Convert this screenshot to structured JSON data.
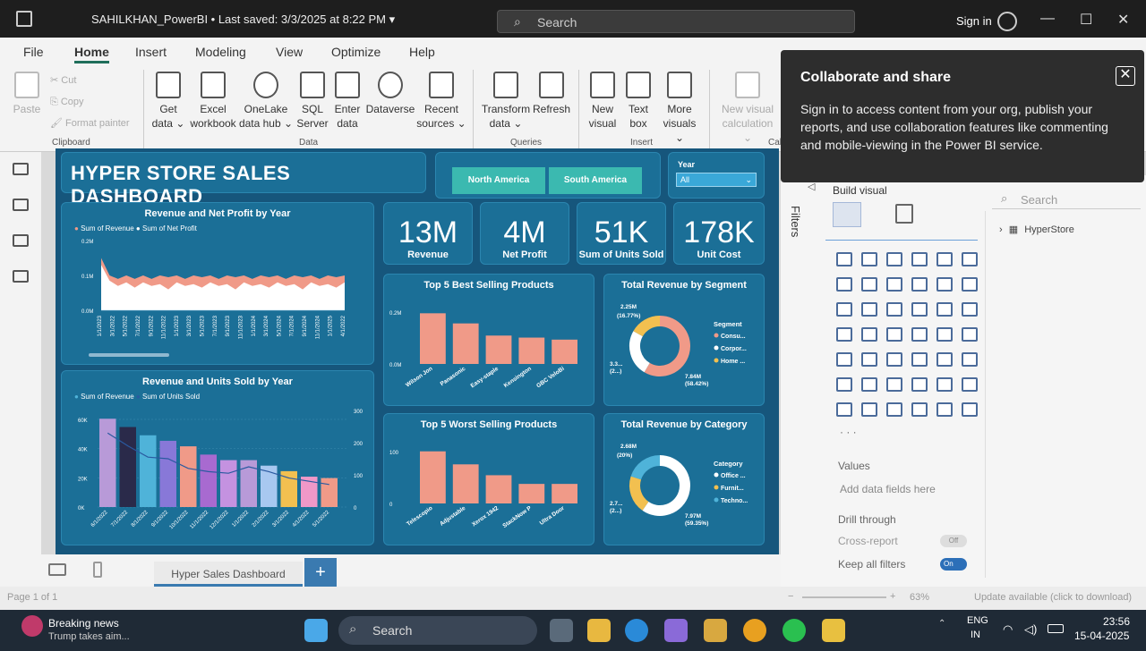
{
  "titlebar": {
    "title": "SAHILKHAN_PowerBI • Last saved: 3/3/2025 at 8:22 PM  ▾",
    "search_placeholder": "Search",
    "signin": "Sign in"
  },
  "ribbon": {
    "menus": [
      "File",
      "Home",
      "Insert",
      "Modeling",
      "View",
      "Optimize",
      "Help"
    ],
    "clipboard": {
      "paste": "Paste",
      "cut": "Cut",
      "copy": "Copy",
      "format_painter": "Format painter",
      "group": "Clipboard"
    },
    "data_buttons": [
      {
        "l1": "Get",
        "l2": "data ⌄"
      },
      {
        "l1": "Excel",
        "l2": "workbook"
      },
      {
        "l1": "OneLake",
        "l2": "data hub ⌄"
      },
      {
        "l1": "SQL",
        "l2": "Server"
      },
      {
        "l1": "Enter",
        "l2": "data"
      },
      {
        "l1": "Dataverse",
        "l2": ""
      },
      {
        "l1": "Recent",
        "l2": "sources ⌄"
      }
    ],
    "data_group": "Data",
    "queries_buttons": [
      {
        "l1": "Transform",
        "l2": "data ⌄"
      },
      {
        "l1": "Refresh",
        "l2": ""
      }
    ],
    "queries_group": "Queries",
    "insert_buttons": [
      {
        "l1": "New",
        "l2": "visual"
      },
      {
        "l1": "Text",
        "l2": "box"
      },
      {
        "l1": "More",
        "l2": "visuals ⌄"
      }
    ],
    "insert_group": "Insert",
    "calc_button": {
      "l1": "New visual",
      "l2": "calculation ⌄"
    },
    "calc_group": "Cal"
  },
  "tooltip": {
    "heading": "Collaborate and share",
    "body": "Sign in to access content from your org, publish your reports, and use collaboration features like commenting and mobile-viewing in the Power BI service."
  },
  "dashboard": {
    "title": "HYPER STORE SALES DASHBOARD",
    "regions": [
      "North America",
      "South America"
    ],
    "year_label": "Year",
    "year_value": "All",
    "kpis": [
      {
        "value": "13M",
        "label": "Revenue"
      },
      {
        "value": "4M",
        "label": "Net Profit"
      },
      {
        "value": "51K",
        "label": "Sum of Units Sold"
      },
      {
        "value": "178K",
        "label": "Unit Cost"
      }
    ]
  },
  "chart_data": [
    {
      "type": "area",
      "title": "Revenue and Net Profit by Year",
      "legend": [
        "Sum of Revenue",
        "Sum of Net Profit"
      ],
      "y_ticks": [
        "0.2M",
        "0.1M",
        "0.0M"
      ],
      "x_ticks": [
        "1/1/2023",
        "3/1/2022",
        "5/1/2022",
        "7/1/2022",
        "9/1/2022",
        "11/1/2022",
        "1/1/2023",
        "3/1/2023",
        "5/1/2023",
        "7/1/2023",
        "9/1/2023",
        "11/1/2023",
        "1/1/2024",
        "3/1/2024",
        "5/1/2024",
        "7/1/2024",
        "9/1/2024",
        "11/1/2024",
        "1/1/2025",
        "4/1/2022"
      ],
      "series": [
        {
          "name": "Sum of Revenue",
          "values": [
            0.15,
            0.1,
            0.09,
            0.1,
            0.09,
            0.1,
            0.09,
            0.1,
            0.095,
            0.1,
            0.09,
            0.1,
            0.095,
            0.1,
            0.09,
            0.1,
            0.095,
            0.1,
            0.09,
            0.1,
            0.095,
            0.1,
            0.09,
            0.1,
            0.095,
            0.1,
            0.09,
            0.1,
            0.095,
            0.1
          ]
        },
        {
          "name": "Sum of Net Profit",
          "values": [
            0.13,
            0.085,
            0.07,
            0.08,
            0.065,
            0.08,
            0.07,
            0.075,
            0.06,
            0.08,
            0.07,
            0.075,
            0.065,
            0.08,
            0.07,
            0.075,
            0.06,
            0.08,
            0.07,
            0.075,
            0.065,
            0.08,
            0.07,
            0.075,
            0.06,
            0.08,
            0.07,
            0.075,
            0.065,
            0.08
          ]
        }
      ],
      "ylim": [
        0,
        0.2
      ]
    },
    {
      "type": "bar",
      "title": "Revenue and Units Sold by Year",
      "legend": [
        "Sum of Revenue",
        "Sum of Units Sold"
      ],
      "y_ticks": [
        "60K",
        "40K",
        "20K",
        "0K"
      ],
      "y2_ticks": [
        "300",
        "200",
        "100",
        "0"
      ],
      "categories": [
        "6/1/2022",
        "7/1/2022",
        "8/1/2022",
        "9/1/2022",
        "10/1/2022",
        "11/1/2022",
        "12/1/2022",
        "1/1/2022",
        "2/1/2022",
        "3/1/2022",
        "4/1/2022",
        "5/1/2022"
      ],
      "values": [
        64000,
        58000,
        52000,
        48000,
        44000,
        38000,
        34000,
        34000,
        30000,
        26000,
        22000,
        21000
      ],
      "colors": [
        "#b89ad8",
        "#2a2a4a",
        "#4fb3d9",
        "#8878d8",
        "#f09a88",
        "#a86ad0",
        "#c492e0",
        "#b89ad8",
        "#a8c8f0",
        "#f2c050",
        "#f098c8",
        "#f09a88"
      ],
      "series2": [
        {
          "name": "Sum of Units Sold",
          "values": [
            230,
            190,
            155,
            150,
            120,
            110,
            105,
            125,
            110,
            90,
            80,
            70
          ]
        }
      ],
      "ylim": [
        0,
        70000
      ]
    },
    {
      "type": "bar",
      "title": "Top 5 Best Selling Products",
      "y_ticks": [
        "0.2M",
        "0.0M"
      ],
      "categories": [
        "Wilson Jon",
        "Panasonic",
        "Easy-staple",
        "Kensington",
        "GBC VeloBi"
      ],
      "values": [
        0.25,
        0.2,
        0.14,
        0.13,
        0.12
      ],
      "ylim": [
        0,
        0.3
      ]
    },
    {
      "type": "pie",
      "title": "Total Revenue by Segment",
      "legend_title": "Segment",
      "labels": [
        "Consu...",
        "Corpor...",
        "Home ..."
      ],
      "values": [
        7.84,
        3.3,
        2.25
      ],
      "colors": [
        "#f09a88",
        "#ffffff",
        "#f2c050"
      ],
      "data_labels": [
        "2.25M",
        "(16.77%)",
        "3.3...",
        "(2...)",
        "7.84M",
        "(58.42%)"
      ]
    },
    {
      "type": "bar",
      "title": "Top 5 Worst Selling Products",
      "y_ticks": [
        "100",
        "0"
      ],
      "categories": [
        "Telescopio",
        "Adjustable",
        "Xerox 1942",
        "StackNow P",
        "Ultra Door"
      ],
      "values": [
        120,
        90,
        65,
        45,
        45
      ],
      "ylim": [
        0,
        140
      ]
    },
    {
      "type": "pie",
      "title": "Total Revenue by Category",
      "legend_title": "Category",
      "labels": [
        "Office ...",
        "Furnit...",
        "Techno..."
      ],
      "values": [
        7.97,
        2.7,
        2.68
      ],
      "colors": [
        "#ffffff",
        "#f2c050",
        "#4fb3d9"
      ],
      "data_labels": [
        "2.68M",
        "(20%)",
        "2.7...",
        "(2...)",
        "7.97M",
        "(59.35%)"
      ]
    }
  ],
  "pages": {
    "tab": "Hyper Sales Dashboard",
    "page_count": "Page 1 of 1"
  },
  "status": {
    "zoom": "63%",
    "update": "Update available (click to download)"
  },
  "rightpane": {
    "filters": "Filters",
    "build_visual": "Build visual",
    "search_placeholder": "Search",
    "tree_item": "HyperStore",
    "values_label": "Values",
    "values_placeholder": "Add data fields here",
    "drill_through": "Drill through",
    "cross_report": "Cross-report",
    "cross_report_state": "Off",
    "keep_filters": "Keep all filters",
    "keep_filters_state": "On"
  },
  "taskbar": {
    "news_title": "Breaking news",
    "news_sub": "Trump takes aim...",
    "search": "Search",
    "lang1": "ENG",
    "lang2": "IN",
    "time": "23:56",
    "date": "15-04-2025"
  }
}
